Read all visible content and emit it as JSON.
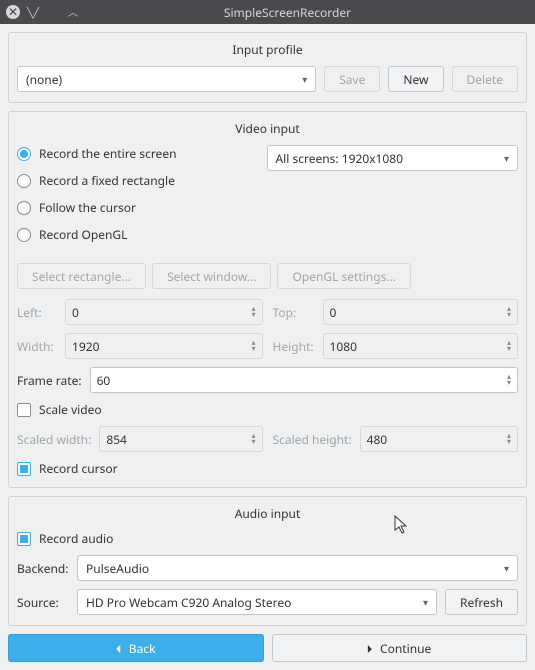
{
  "window": {
    "title": "SimpleScreenRecorder"
  },
  "input_profile": {
    "title": "Input profile",
    "value": "(none)",
    "save": "Save",
    "new": "New",
    "delete": "Delete"
  },
  "video": {
    "title": "Video input",
    "record_entire": "Record the entire screen",
    "record_fixed": "Record a fixed rectangle",
    "follow_cursor": "Follow the cursor",
    "record_opengl": "Record OpenGL",
    "screen_select": "All screens: 1920x1080",
    "select_rectangle": "Select rectangle...",
    "select_window": "Select window...",
    "opengl_settings": "OpenGL settings...",
    "left_label": "Left:",
    "left": "0",
    "top_label": "Top:",
    "top": "0",
    "width_label": "Width:",
    "width": "1920",
    "height_label": "Height:",
    "height": "1080",
    "frame_rate_label": "Frame rate:",
    "frame_rate": "60",
    "scale_video": "Scale video",
    "scaled_width_label": "Scaled width:",
    "scaled_width": "854",
    "scaled_height_label": "Scaled height:",
    "scaled_height": "480",
    "record_cursor": "Record cursor"
  },
  "audio": {
    "title": "Audio input",
    "record_audio": "Record audio",
    "backend_label": "Backend:",
    "backend": "PulseAudio",
    "source_label": "Source:",
    "source": "HD Pro Webcam C920 Analog Stereo",
    "refresh": "Refresh"
  },
  "footer": {
    "back": "Back",
    "continue": "Continue"
  }
}
